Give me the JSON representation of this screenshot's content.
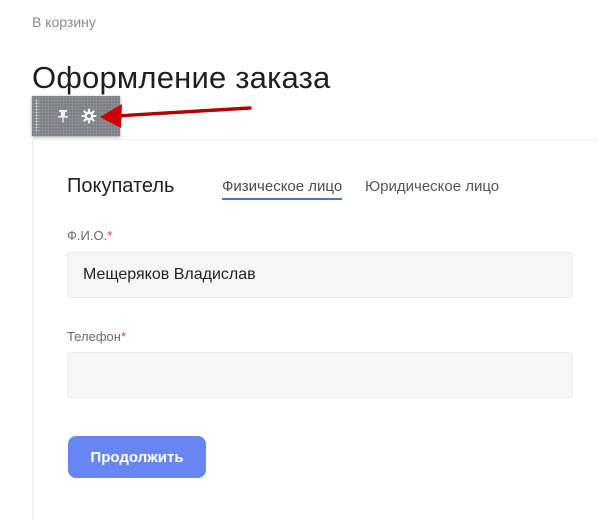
{
  "header": {
    "back_link": "В корзину",
    "title": "Оформление заказа"
  },
  "toolbar": {
    "icons": [
      "drag-handle-icon",
      "pin-icon",
      "gear-icon"
    ],
    "arrow_color": "#cc0000"
  },
  "buyer": {
    "section_title": "Покупатель",
    "tabs": [
      {
        "label": "Физическое лицо",
        "active": true
      },
      {
        "label": "Юридическое лицо",
        "active": false
      }
    ]
  },
  "form": {
    "name": {
      "label": "Ф.И.О.",
      "required_mark": "*",
      "value": "Мещеряков Владислав",
      "placeholder": ""
    },
    "phone": {
      "label": "Телефон",
      "required_mark": "*",
      "value": "",
      "placeholder": ""
    },
    "submit_label": "Продолжить"
  },
  "colors": {
    "accent": "#4d6fd8",
    "button": "#6886f2",
    "required": "#e53935"
  }
}
